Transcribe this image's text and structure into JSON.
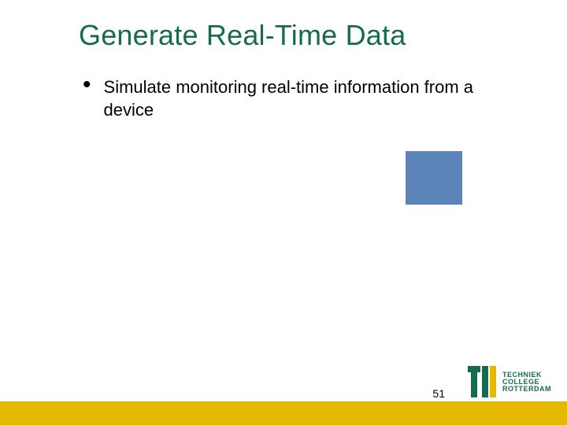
{
  "title": "Generate Real-Time Data",
  "bullets": [
    "Simulate monitoring real-time information from a device"
  ],
  "page_number": "51",
  "logo": {
    "line1": "TECHNIEK",
    "line2": "COLLEGE",
    "line3": "ROTTERDAM"
  },
  "decoration": {
    "blue_square_color": "#5b84b8"
  }
}
